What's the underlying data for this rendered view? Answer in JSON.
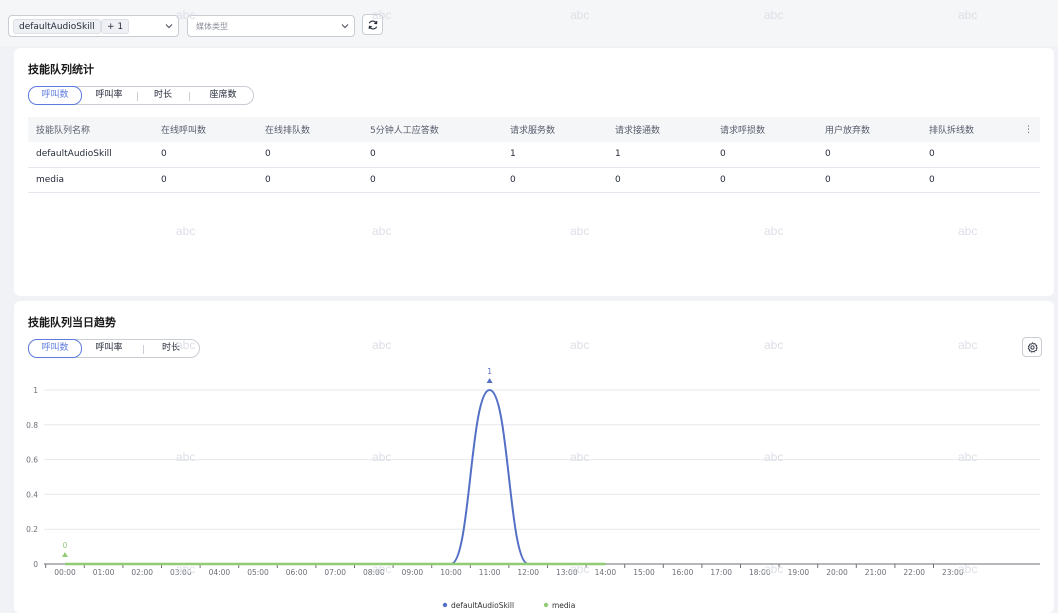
{
  "filters": {
    "skill_tag": "defaultAudioSkill",
    "skill_more": "+ 1",
    "media_placeholder": "媒体类型"
  },
  "stats_card": {
    "title": "技能队列统计",
    "tabs": [
      "呼叫数",
      "呼叫率",
      "时长",
      "座席数"
    ],
    "columns": [
      "技能队列名称",
      "在线呼叫数",
      "在线排队数",
      "5分钟人工应答数",
      "请求服务数",
      "请求接通数",
      "请求呼损数",
      "用户放弃数",
      "排队拆线数"
    ],
    "rows": [
      [
        "defaultAudioSkill",
        "0",
        "0",
        "0",
        "1",
        "1",
        "0",
        "0",
        "0"
      ],
      [
        "media",
        "0",
        "0",
        "0",
        "0",
        "0",
        "0",
        "0",
        "0"
      ]
    ],
    "more_icon": "⋮"
  },
  "trend_card": {
    "title": "技能队列当日趋势",
    "tabs": [
      "呼叫数",
      "呼叫率",
      "时长"
    ],
    "settings_icon": "gear-icon"
  },
  "watermark": "abc",
  "chart_data": {
    "type": "line",
    "x": [
      "00:00",
      "01:00",
      "02:00",
      "03:00",
      "04:00",
      "05:00",
      "06:00",
      "07:00",
      "08:00",
      "09:00",
      "10:00",
      "11:00",
      "12:00",
      "13:00",
      "14:00",
      "15:00",
      "16:00",
      "17:00",
      "18:00",
      "19:00",
      "20:00",
      "21:00",
      "22:00",
      "23:00"
    ],
    "y_ticks": [
      "0",
      "0.2",
      "0.4",
      "0.6",
      "0.8",
      "1"
    ],
    "ylim": [
      0,
      1.1
    ],
    "series": [
      {
        "name": "defaultAudioSkill",
        "color": "#5470c6",
        "values": [
          0,
          0,
          0,
          0,
          0,
          0,
          0,
          0,
          0,
          0,
          0,
          1,
          0,
          0,
          0
        ]
      },
      {
        "name": "media",
        "color": "#91cc75",
        "values": [
          0,
          0,
          0,
          0,
          0,
          0,
          0,
          0,
          0,
          0,
          0,
          0,
          0,
          0,
          0
        ]
      }
    ],
    "annotations": [
      {
        "series": "defaultAudioSkill",
        "x": "11:00",
        "label": "1"
      },
      {
        "series": "media",
        "x": "00:00",
        "label": "0"
      }
    ],
    "legend_position": "bottom-center",
    "grid": true
  }
}
